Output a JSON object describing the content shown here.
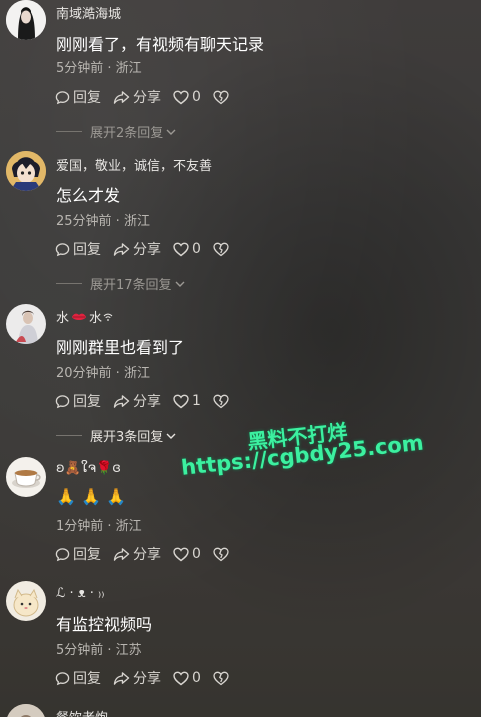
{
  "comments": [
    {
      "username": "南域澔海城",
      "text": "刚刚看了，有视频有聊天记录",
      "meta": "5分钟前 · 浙江",
      "reply_label": "回复",
      "share_label": "分享",
      "like_count": "0",
      "expand_label": "展开2条回复"
    },
    {
      "username": "爱国，敬业，诚信，不友善",
      "text": "怎么才发",
      "meta": "25分钟前 · 浙江",
      "reply_label": "回复",
      "share_label": "分享",
      "like_count": "0",
      "expand_label": "展开17条回复"
    },
    {
      "username": "水",
      "text": "刚刚群里也看到了",
      "meta": "20分钟前 · 浙江",
      "reply_label": "回复",
      "share_label": "分享",
      "like_count": "1",
      "expand_label": "展开3条回复"
    },
    {
      "username": "ʚ🧸ໃຈ🌹ɞ",
      "text": "🙏 🙏 🙏",
      "meta": "1分钟前 · 浙江",
      "reply_label": "回复",
      "share_label": "分享",
      "like_count": "0"
    },
    {
      "username": "ℒ · ᴥ · ₎₎",
      "text": "有监控视频吗",
      "meta": "5分钟前 · 江苏",
      "reply_label": "回复",
      "share_label": "分享",
      "like_count": "0"
    },
    {
      "username": "餐饮老炮"
    }
  ],
  "watermark": {
    "line1": "黑料不打烊",
    "line2": "https://cgbdy25.com",
    "color": "#3cf0a0"
  },
  "colors": {
    "like_active": "#ffffff",
    "meta": "#b9b6b1"
  }
}
